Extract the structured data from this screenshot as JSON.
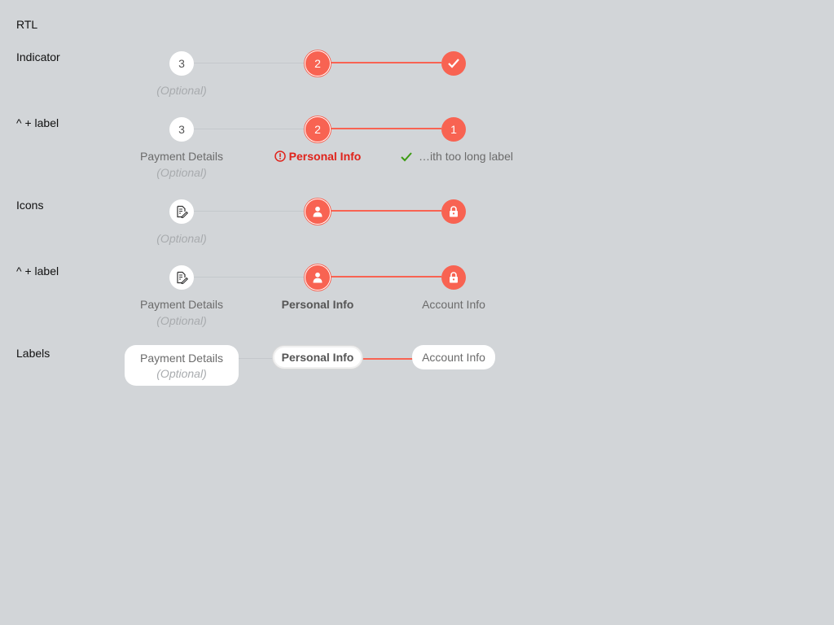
{
  "header": {
    "title": "RTL"
  },
  "rows": [
    {
      "label": "Indicator",
      "step3": "3",
      "step2": "2",
      "step3_optional": "(Optional)"
    },
    {
      "label": "^ + label",
      "step3": "3",
      "step2": "2",
      "step1": "1",
      "step3_label": "Payment Details",
      "step3_optional": "(Optional)",
      "step2_label": "Personal Info",
      "step1_label": "…ith too long label"
    },
    {
      "label": "Icons",
      "step3_optional": "(Optional)"
    },
    {
      "label": "^ + label",
      "step3_label": "Payment Details",
      "step3_optional": "(Optional)",
      "step2_label": "Personal Info",
      "step1_label": "Account Info"
    },
    {
      "label": "Labels",
      "step3_label": "Payment Details",
      "step3_optional": "(Optional)",
      "step2_label": "Personal Info",
      "step1_label": "Account Info"
    }
  ],
  "colors": {
    "accent": "#f86352",
    "error": "#e0221a",
    "success": "#3c9b12",
    "background": "#d2d5d8"
  },
  "icons": {
    "step3": "edit-document-icon",
    "step2": "user-icon",
    "step1": "lock-icon",
    "completed": "checkmark-icon",
    "error": "exclamation-circle-icon"
  }
}
